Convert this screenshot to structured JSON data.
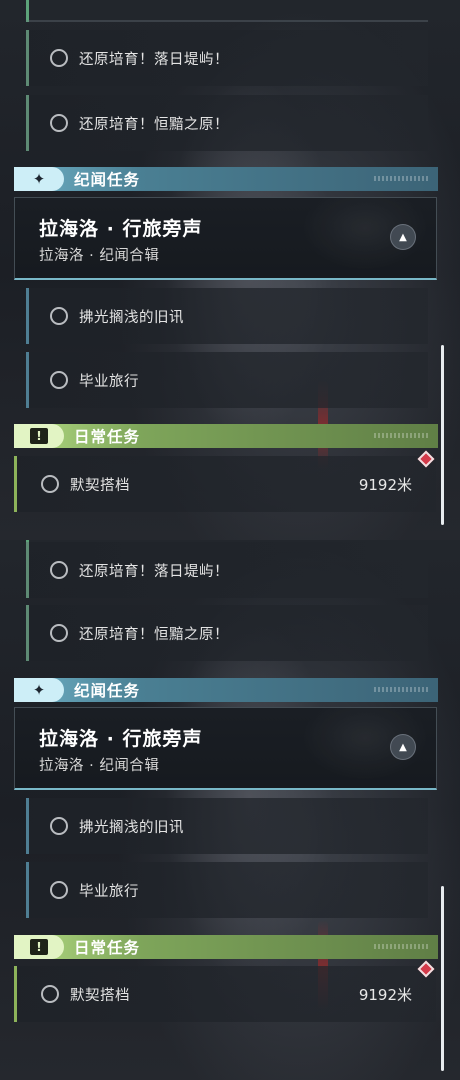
{
  "quests": {
    "q1_label": "还原培育！落日堤屿！",
    "q2_label": "还原培育！恒黯之原！",
    "story_category": "纪闻任务",
    "story_card_title": "拉海洛 · 行旅旁声",
    "story_card_subtitle": "拉海洛 · 纪闻合辑",
    "story_item1": "拂光搁浅的旧讯",
    "story_item2": "毕业旅行",
    "daily_category": "日常任务",
    "daily_item1": "默契搭档",
    "daily_item1_distance": "9192米",
    "collapse_glyph": "▲",
    "story_icon_glyph": "✦",
    "daily_icon_glyph": "!"
  },
  "colors": {
    "story_accent": "#6fb1c6",
    "daily_accent": "#b4dc84",
    "tracked_marker": "#d33a4a",
    "quest_bar_green": "#5e8a74"
  },
  "icons": {
    "category_story": "sparkle-icon",
    "category_daily": "exclamation-box-icon",
    "quest_status": "ring-icon",
    "collapse": "chevron-up-icon",
    "tracked": "diamond-marker-icon"
  }
}
